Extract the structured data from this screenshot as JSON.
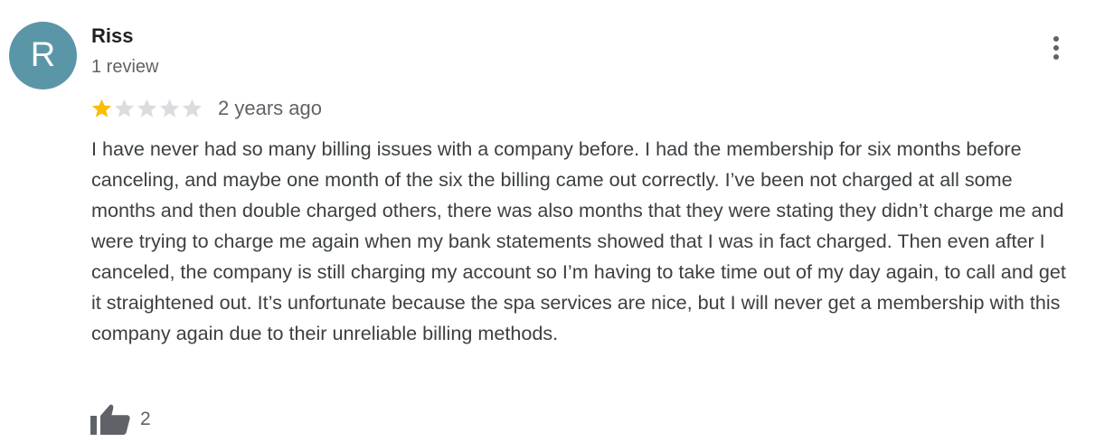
{
  "review": {
    "author": {
      "initial": "R",
      "avatar_color": "#5a96a8",
      "name": "Riss",
      "meta": "1 review"
    },
    "rating": {
      "value": 1,
      "max": 5,
      "filled_color": "#fbbc04",
      "empty_color": "#dadce0"
    },
    "date": "2 years ago",
    "text": "I have never had so many billing issues with a company before. I had the membership for six months before canceling, and maybe one month of the six the billing came out correctly. I’ve been not charged at all some months and then double charged others, there was also months that they were stating they didn’t charge me and were trying to charge me again when my bank statements showed that I was in fact charged. Then even after I canceled, the company is still charging my account so I’m having to take time out of my day again, to call and get it straightened out. It’s unfortunate because the spa services are nice, but I will never get a membership with this company again due to their unreliable billing methods.",
    "likes": {
      "icon": "thumbs-up-icon",
      "count": "2"
    },
    "menu_icon": "more-vert-icon"
  }
}
